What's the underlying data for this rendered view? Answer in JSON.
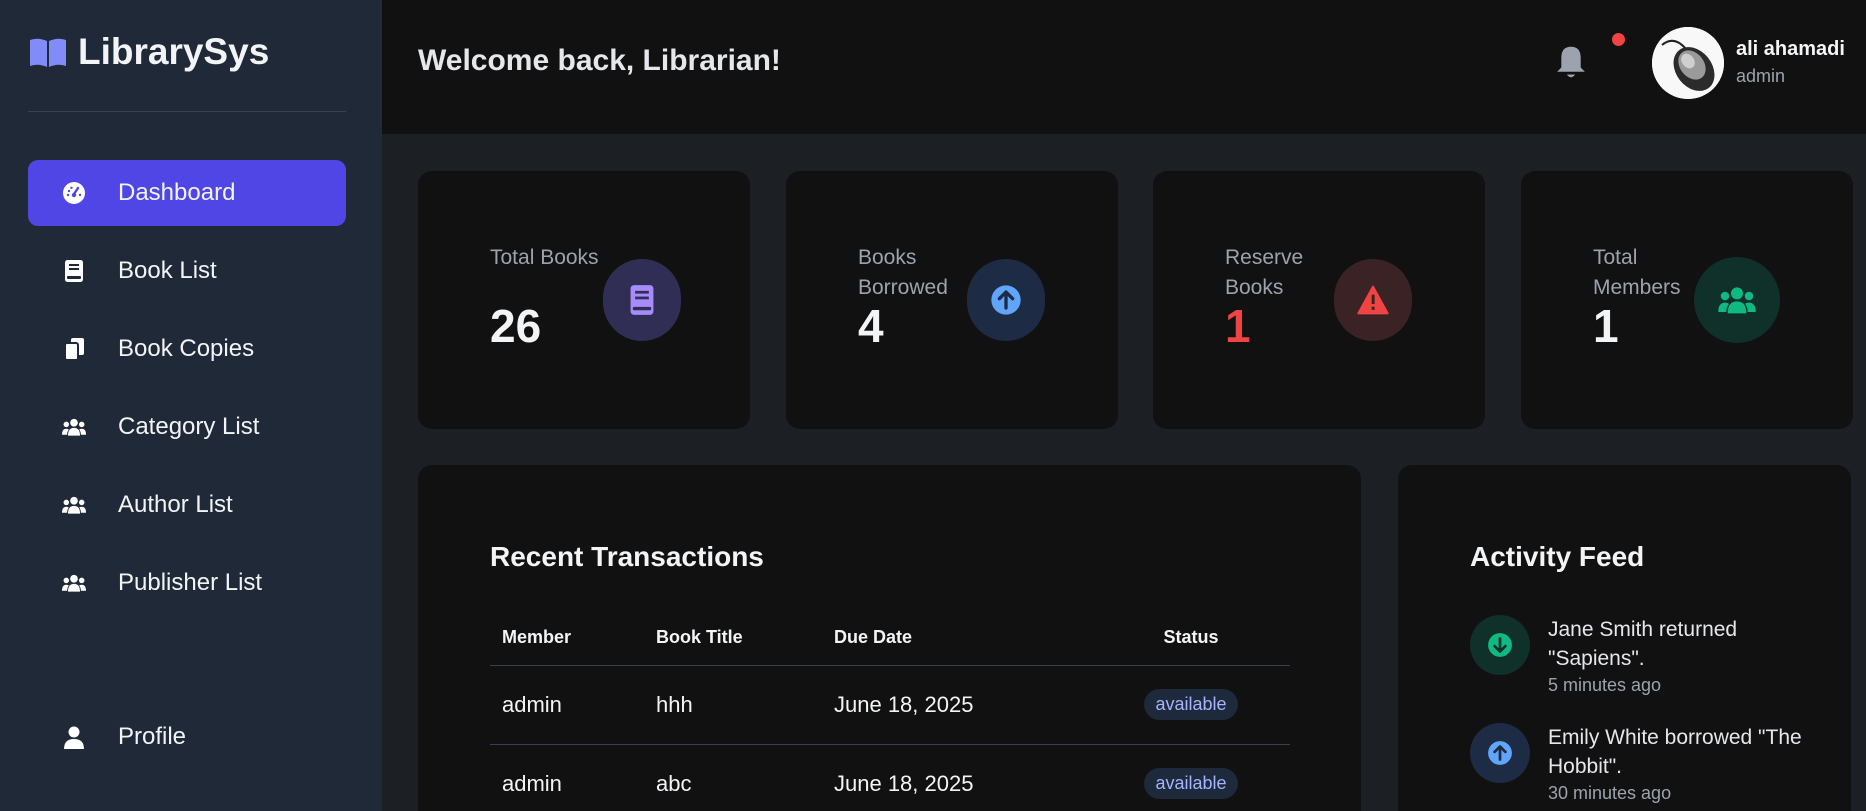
{
  "brand": {
    "title": "LibrarySys"
  },
  "nav": {
    "items": [
      {
        "label": "Dashboard",
        "icon": "dashboard-icon",
        "active": true
      },
      {
        "label": "Book List",
        "icon": "book-icon"
      },
      {
        "label": "Book Copies",
        "icon": "copies-icon"
      },
      {
        "label": "Category List",
        "icon": "users-icon"
      },
      {
        "label": "Author List",
        "icon": "users-icon"
      },
      {
        "label": "Publisher List",
        "icon": "users-icon"
      }
    ],
    "profile": {
      "label": "Profile",
      "icon": "user-icon"
    }
  },
  "header": {
    "welcome": "Welcome back, Librarian!",
    "user": {
      "name": "ali ahamadi",
      "role": "admin"
    }
  },
  "stats": [
    {
      "label": "Total Books",
      "value": "26",
      "icon": "book-icon",
      "color": "#a78bfa"
    },
    {
      "label": "Books Borrowed",
      "value": "4",
      "icon": "arrow-up-icon",
      "color": "#60a5fa"
    },
    {
      "label": "Reserve Books",
      "value": "1",
      "icon": "warning-icon",
      "color": "#ef4444"
    },
    {
      "label": "Total Members",
      "value": "1",
      "icon": "users-icon",
      "color": "#10b981"
    }
  ],
  "transactions": {
    "title": "Recent Transactions",
    "columns": [
      "Member",
      "Book Title",
      "Due Date",
      "Status"
    ],
    "rows": [
      {
        "member": "admin",
        "book": "hhh",
        "due": "June 18, 2025",
        "status": "available"
      },
      {
        "member": "admin",
        "book": "abc",
        "due": "June 18, 2025",
        "status": "available"
      }
    ]
  },
  "activity": {
    "title": "Activity Feed",
    "items": [
      {
        "text": "Jane Smith returned \"Sapiens\".",
        "time": "5 minutes ago",
        "icon": "arrow-down-icon",
        "color": "#10b981"
      },
      {
        "text": "Emily White borrowed \"The Hobbit\".",
        "time": "30 minutes ago",
        "icon": "arrow-up-icon",
        "color": "#60a5fa"
      }
    ]
  }
}
